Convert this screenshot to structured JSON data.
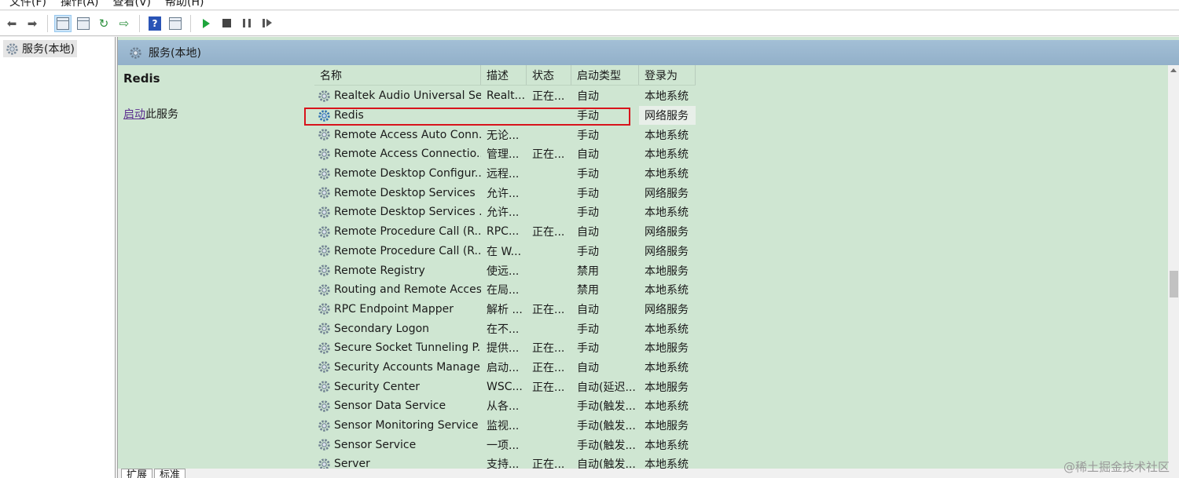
{
  "menu": [
    "文件(F)",
    "操作(A)",
    "查看(V)",
    "帮助(H)"
  ],
  "toolbar": {
    "icons": [
      "back-arrow-icon",
      "forward-arrow-icon",
      "console-tree-icon",
      "properties-icon",
      "refresh-icon",
      "export-list-icon",
      "help-icon",
      "show-hide-pane-icon",
      "start-service-icon",
      "stop-service-icon",
      "pause-service-icon",
      "resume-service-icon"
    ],
    "help_glyph": "?"
  },
  "tree": {
    "root_label": "服务(本地)"
  },
  "panel": {
    "header_title": "服务(本地)",
    "selected_service": "Redis",
    "start_link": "启动",
    "start_suffix": "此服务"
  },
  "table": {
    "columns": {
      "name": "名称",
      "desc": "描述",
      "state": "状态",
      "startup": "启动类型",
      "logon": "登录为"
    },
    "rows": [
      {
        "name": "Realtek Audio Universal Se...",
        "desc": "Realt...",
        "state": "正在...",
        "startup": "自动",
        "logon": "本地系统"
      },
      {
        "name": "Redis",
        "desc": "",
        "state": "",
        "startup": "手动",
        "logon": "网络服务"
      },
      {
        "name": "Remote Access Auto Conn...",
        "desc": "无论...",
        "state": "",
        "startup": "手动",
        "logon": "本地系统"
      },
      {
        "name": "Remote Access Connectio...",
        "desc": "管理...",
        "state": "正在...",
        "startup": "自动",
        "logon": "本地系统"
      },
      {
        "name": "Remote Desktop Configur...",
        "desc": "远程...",
        "state": "",
        "startup": "手动",
        "logon": "本地系统"
      },
      {
        "name": "Remote Desktop Services",
        "desc": "允许...",
        "state": "",
        "startup": "手动",
        "logon": "网络服务"
      },
      {
        "name": "Remote Desktop Services ...",
        "desc": "允许...",
        "state": "",
        "startup": "手动",
        "logon": "本地系统"
      },
      {
        "name": "Remote Procedure Call (R...",
        "desc": "RPC...",
        "state": "正在...",
        "startup": "自动",
        "logon": "网络服务"
      },
      {
        "name": "Remote Procedure Call (R...",
        "desc": "在 W...",
        "state": "",
        "startup": "手动",
        "logon": "网络服务"
      },
      {
        "name": "Remote Registry",
        "desc": "使远...",
        "state": "",
        "startup": "禁用",
        "logon": "本地服务"
      },
      {
        "name": "Routing and Remote Access",
        "desc": "在局...",
        "state": "",
        "startup": "禁用",
        "logon": "本地系统"
      },
      {
        "name": "RPC Endpoint Mapper",
        "desc": "解析 ...",
        "state": "正在...",
        "startup": "自动",
        "logon": "网络服务"
      },
      {
        "name": "Secondary Logon",
        "desc": "在不...",
        "state": "",
        "startup": "手动",
        "logon": "本地系统"
      },
      {
        "name": "Secure Socket Tunneling P...",
        "desc": "提供...",
        "state": "正在...",
        "startup": "手动",
        "logon": "本地服务"
      },
      {
        "name": "Security Accounts Manager",
        "desc": "启动...",
        "state": "正在...",
        "startup": "自动",
        "logon": "本地系统"
      },
      {
        "name": "Security Center",
        "desc": "WSC...",
        "state": "正在...",
        "startup": "自动(延迟...",
        "logon": "本地服务"
      },
      {
        "name": "Sensor Data Service",
        "desc": "从各...",
        "state": "",
        "startup": "手动(触发...",
        "logon": "本地系统"
      },
      {
        "name": "Sensor Monitoring Service",
        "desc": "监视...",
        "state": "",
        "startup": "手动(触发...",
        "logon": "本地服务"
      },
      {
        "name": "Sensor Service",
        "desc": "一项...",
        "state": "",
        "startup": "手动(触发...",
        "logon": "本地系统"
      },
      {
        "name": "Server",
        "desc": "支持...",
        "state": "正在...",
        "startup": "自动(触发...",
        "logon": "本地系统"
      }
    ]
  },
  "tabs": [
    "扩展",
    "标准"
  ],
  "watermark": "@稀土掘金技术社区",
  "colors": {
    "panel_bg": "#cfe6d2",
    "highlight_border": "#d8141c",
    "link": "#5b2d8e"
  }
}
